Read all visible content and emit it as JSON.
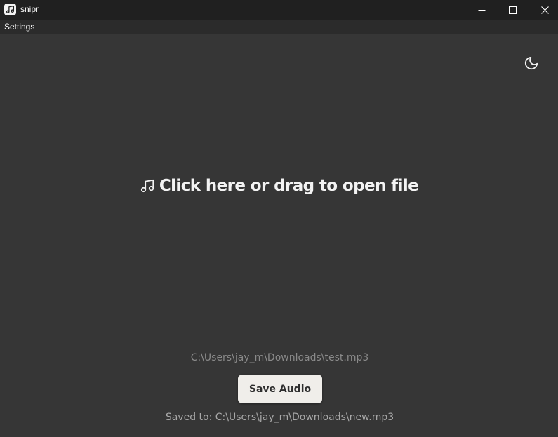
{
  "window": {
    "title": "snipr",
    "app_icon": "music-note-icon",
    "controls": [
      "minimize-icon",
      "maximize-icon",
      "close-icon"
    ]
  },
  "menubar": {
    "items": [
      {
        "label": "Settings"
      }
    ]
  },
  "theme_toggle": {
    "icon": "moon-icon"
  },
  "drop_zone": {
    "icon": "music-note-icon",
    "label": "Click here or drag to open file"
  },
  "file": {
    "path": "C:\\Users\\jay_m\\Downloads\\test.mp3"
  },
  "actions": {
    "save_label": "Save Audio"
  },
  "status": {
    "saved_to": "Saved to: C:\\Users\\jay_m\\Downloads\\new.mp3"
  },
  "colors": {
    "background": "#363636",
    "titlebar": "#202020",
    "menubar": "#2b2b2b",
    "button_bg": "#f0eeea",
    "text_primary": "#f3f3f3",
    "text_muted": "#8a8a8a"
  }
}
